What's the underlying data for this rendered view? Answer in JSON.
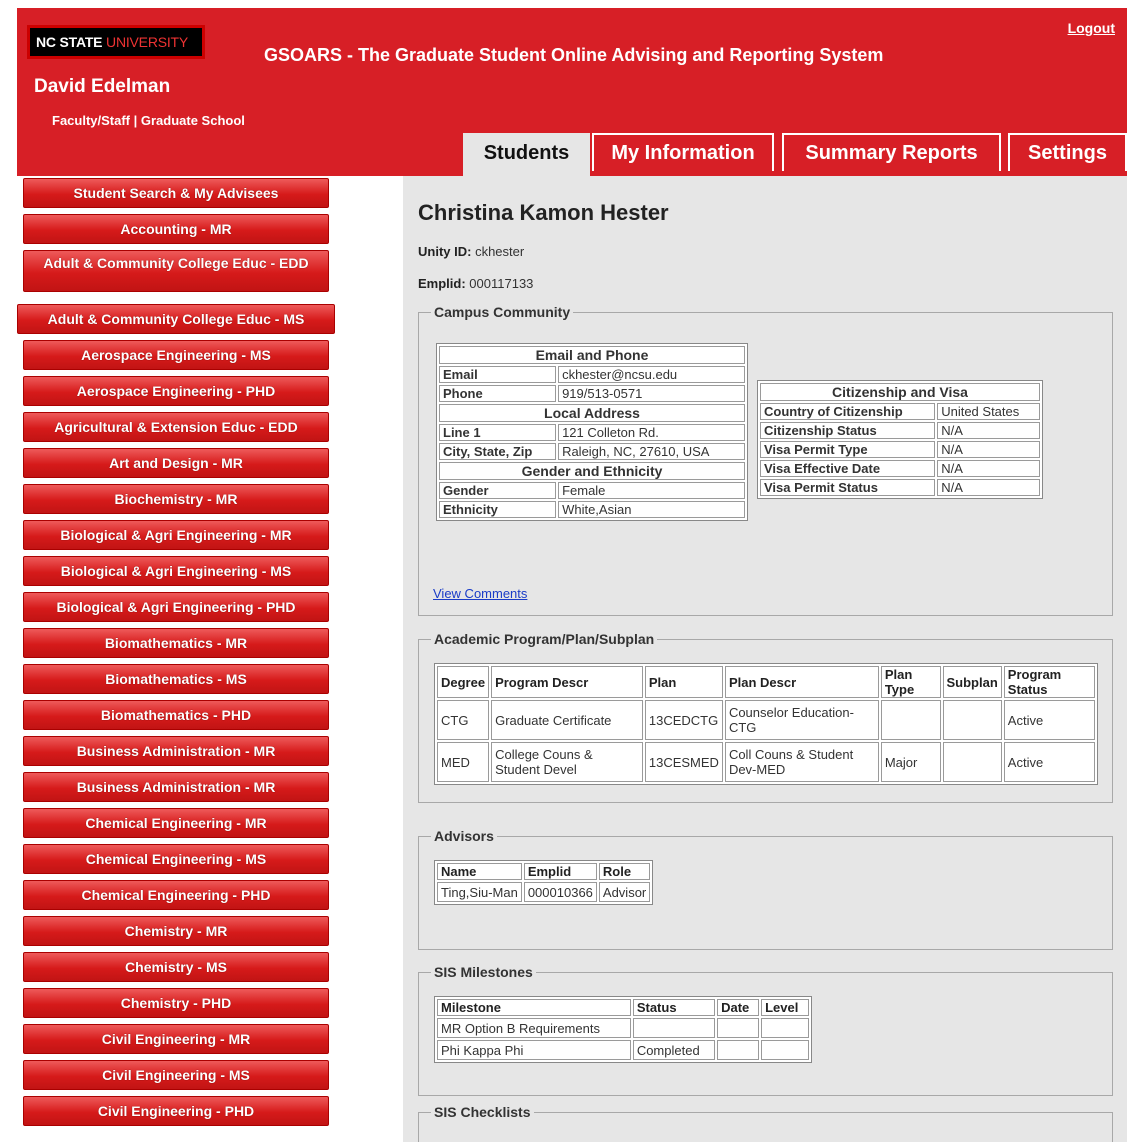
{
  "header": {
    "logo_bold": "NC STATE",
    "logo_light": "UNIVERSITY",
    "app_title": "GSOARS - The Graduate Student Online Advising and Reporting System",
    "logout": "Logout",
    "user_name": "David Edelman",
    "user_role": "Faculty/Staff | Graduate School"
  },
  "tabs": [
    {
      "label": "Students",
      "active": true
    },
    {
      "label": "My Information",
      "active": false
    },
    {
      "label": "Summary Reports",
      "active": false
    },
    {
      "label": "Settings",
      "active": false
    }
  ],
  "sidebar": {
    "items": [
      "Student Search & My Advisees",
      "Accounting - MR",
      "Adult & Community College Educ - EDD",
      "Adult & Community College Educ - MS",
      "Aerospace Engineering - MS",
      "Aerospace Engineering - PHD",
      "Agricultural & Extension Educ - EDD",
      "Art and Design - MR",
      "Biochemistry - MR",
      "Biological & Agri Engineering - MR",
      "Biological & Agri Engineering - MS",
      "Biological & Agri Engineering - PHD",
      "Biomathematics - MR",
      "Biomathematics - MS",
      "Biomathematics - PHD",
      "Business Administration - MR",
      "Business Administration - MR",
      "Chemical Engineering - MR",
      "Chemical Engineering - MS",
      "Chemical Engineering - PHD",
      "Chemistry - MR",
      "Chemistry - MS",
      "Chemistry - PHD",
      "Civil Engineering - MR",
      "Civil Engineering - MS",
      "Civil Engineering - PHD"
    ]
  },
  "student": {
    "name": "Christina Kamon Hester",
    "unity_label": "Unity ID:",
    "unity_id": "ckhester",
    "emplid_label": "Emplid:",
    "emplid": "000117133"
  },
  "campus": {
    "legend": "Campus Community",
    "email_phone_title": "Email and Phone",
    "email_label": "Email",
    "email": "ckhester@ncsu.edu",
    "phone_label": "Phone",
    "phone": "919/513-0571",
    "address_title": "Local Address",
    "line1_label": "Line 1",
    "line1": "121 Colleton Rd.",
    "city_label": "City, State, Zip",
    "city": "Raleigh, NC, 27610, USA",
    "gender_title": "Gender and Ethnicity",
    "gender_label": "Gender",
    "gender": "Female",
    "ethnicity_label": "Ethnicity",
    "ethnicity": "White,Asian",
    "citizenship_title": "Citizenship and Visa",
    "country_label": "Country of Citizenship",
    "country": "United States",
    "cit_status_label": "Citizenship Status",
    "cit_status": "N/A",
    "visa_type_label": "Visa Permit Type",
    "visa_type": "N/A",
    "visa_eff_label": "Visa Effective Date",
    "visa_eff": "N/A",
    "visa_status_label": "Visa Permit Status",
    "visa_status": "N/A",
    "view_comments": "View Comments"
  },
  "academic": {
    "legend": "Academic Program/Plan/Subplan",
    "headers": [
      "Degree",
      "Program Descr",
      "Plan",
      "Plan Descr",
      "Plan Type",
      "Subplan",
      "Program Status"
    ],
    "rows": [
      [
        "CTG",
        "Graduate Certificate",
        "13CEDCTG",
        "Counselor Education-CTG",
        "",
        "",
        "Active"
      ],
      [
        "MED",
        "College Couns & Student Devel",
        "13CESMED",
        "Coll Couns & Student Dev-MED",
        "Major",
        "",
        "Active"
      ]
    ]
  },
  "advisors": {
    "legend": "Advisors",
    "headers": [
      "Name",
      "Emplid",
      "Role"
    ],
    "rows": [
      [
        "Ting,Siu-Man",
        "000010366",
        "Advisor"
      ]
    ]
  },
  "milestones": {
    "legend": "SIS Milestones",
    "headers": [
      "Milestone",
      "Status",
      "Date",
      "Level"
    ],
    "rows": [
      [
        "MR Option B Requirements",
        "",
        "",
        ""
      ],
      [
        "Phi Kappa Phi",
        "Completed",
        "",
        ""
      ]
    ]
  },
  "checklists": {
    "legend": "SIS Checklists"
  }
}
